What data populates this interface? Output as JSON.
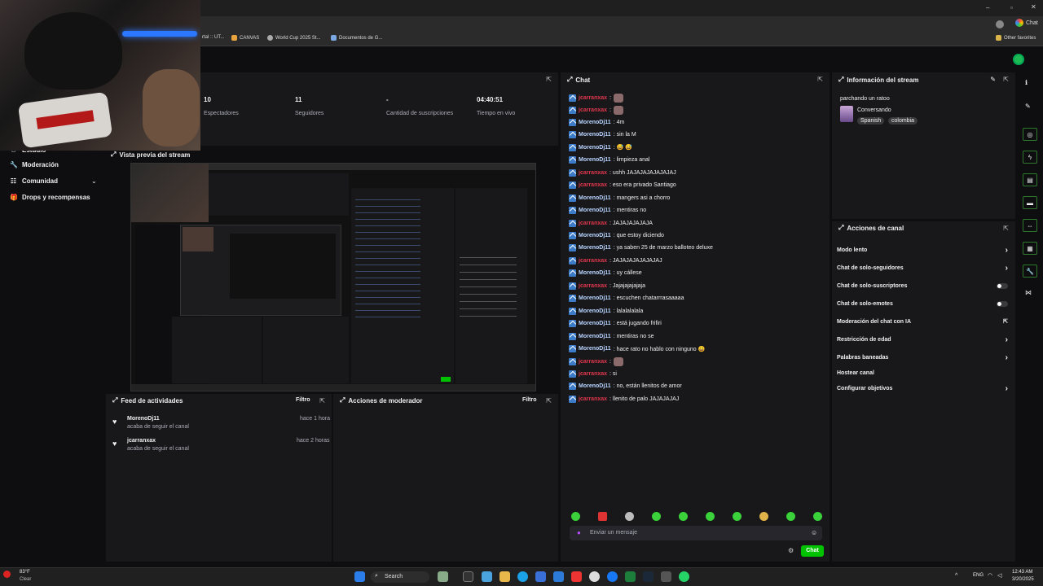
{
  "browser": {
    "bookmarks": [
      {
        "label": "rtal :: UT..."
      },
      {
        "label": "CANVAS"
      },
      {
        "label": "World Cup 2025 St..."
      },
      {
        "label": "Documentos de G..."
      }
    ],
    "other_favorites": "Other favorites",
    "chat_button": "Chat"
  },
  "sidenav": {
    "items": [
      {
        "label": "Estudio",
        "icon": "home-icon"
      },
      {
        "label": "Moderación",
        "icon": "wrench-icon"
      },
      {
        "label": "Comunidad",
        "icon": "community-icon"
      },
      {
        "label": "Drops y recompensas",
        "icon": "gift-icon"
      }
    ]
  },
  "stats": [
    {
      "value": "10",
      "label": "Espectadores"
    },
    {
      "value": "11",
      "label": "Seguidores"
    },
    {
      "value": "-",
      "label": "Cantidad de suscripciones"
    },
    {
      "value": "04:40:51",
      "label": "Tiempo en vivo"
    }
  ],
  "preview": {
    "title": "Vista previa del stream"
  },
  "activity": {
    "title": "Feed de actividades",
    "filter": "Filtro",
    "items": [
      {
        "user": "MorenoDj11",
        "action": "acaba de seguir el canal",
        "time": "hace 1 hora"
      },
      {
        "user": "jcarranxax",
        "action": "acaba de seguir el canal",
        "time": "hace 2 horas"
      }
    ]
  },
  "modactions": {
    "title": "Acciones de moderador",
    "filter": "Filtro"
  },
  "chat": {
    "title": "Chat",
    "messages": [
      {
        "user": "jcarranxax",
        "text": "",
        "emote": true,
        "kind": "u2"
      },
      {
        "user": "jcarranxax",
        "text": "",
        "emote": true,
        "kind": "u2"
      },
      {
        "user": "MorenoDj11",
        "text": ": 4m",
        "emote": false,
        "kind": "u1"
      },
      {
        "user": "MorenoDj11",
        "text": ": sin la M",
        "emote": false,
        "kind": "u1"
      },
      {
        "user": "MorenoDj11",
        "text": ": 😅 😅",
        "emote": false,
        "kind": "u1"
      },
      {
        "user": "MorenoDj11",
        "text": ": limpieza anal",
        "emote": false,
        "kind": "u1"
      },
      {
        "user": "jcarranxax",
        "text": ": ushh JAJAJAJAJAJAJAJ",
        "emote": false,
        "kind": "u2"
      },
      {
        "user": "jcarranxax",
        "text": ": eso era privado Santiago",
        "emote": false,
        "kind": "u2"
      },
      {
        "user": "MorenoDj11",
        "text": ": mangers asi a chorro",
        "emote": false,
        "kind": "u1"
      },
      {
        "user": "MorenoDj11",
        "text": ": mentiras no",
        "emote": false,
        "kind": "u1"
      },
      {
        "user": "jcarranxax",
        "text": ": JAJAJAJAJAJA",
        "emote": false,
        "kind": "u2"
      },
      {
        "user": "MorenoDj11",
        "text": ": que estoy diciendo",
        "emote": false,
        "kind": "u1"
      },
      {
        "user": "MorenoDj11",
        "text": ": ya saben 25 de marzo balloteo deluxe",
        "emote": false,
        "kind": "u1"
      },
      {
        "user": "jcarranxax",
        "text": ": JAJAJAJAJAJAJAJ",
        "emote": false,
        "kind": "u2"
      },
      {
        "user": "MorenoDj11",
        "text": ": uy cállese",
        "emote": false,
        "kind": "u1"
      },
      {
        "user": "jcarranxax",
        "text": ": Jajajajajajaja",
        "emote": false,
        "kind": "u2"
      },
      {
        "user": "MorenoDj11",
        "text": ": escuchen chatarrrasaaaaa",
        "emote": false,
        "kind": "u1"
      },
      {
        "user": "MorenoDj11",
        "text": ": lalalalalala",
        "emote": false,
        "kind": "u1"
      },
      {
        "user": "MorenoDj11",
        "text": ": está jugando frifiri",
        "emote": false,
        "kind": "u1"
      },
      {
        "user": "MorenoDj11",
        "text": ": mentiras no se",
        "emote": false,
        "kind": "u1"
      },
      {
        "user": "MorenoDj11",
        "text": ": hace rato no hablo con ninguno 😄",
        "emote": false,
        "kind": "u1"
      },
      {
        "user": "jcarranxax",
        "text": "",
        "emote": true,
        "kind": "u2"
      },
      {
        "user": "jcarranxax",
        "text": ": si",
        "emote": false,
        "kind": "u2"
      },
      {
        "user": "MorenoDj11",
        "text": ": no, están llenitos de amor",
        "emote": false,
        "kind": "u1"
      },
      {
        "user": "jcarranxax",
        "text": ": llenito de palo JAJAJAJAJ",
        "emote": false,
        "kind": "u2"
      }
    ],
    "placeholder": "Enviar un mensaje",
    "send_label": "Chat"
  },
  "streaminfo": {
    "title": "Información del stream",
    "stream_title": "parchando un ratoo",
    "category": "Conversando",
    "tags": [
      "Spanish",
      "colombia"
    ]
  },
  "channelactions": {
    "title": "Acciones de canal",
    "items": [
      {
        "label": "Modo lento",
        "control": "arrow"
      },
      {
        "label": "Chat de solo-seguidores",
        "control": "arrow"
      },
      {
        "label": "Chat de solo-suscriptores",
        "control": "toggle"
      },
      {
        "label": "Chat de solo-emotes",
        "control": "toggle"
      },
      {
        "label": "Moderación del chat con IA",
        "control": "external"
      },
      {
        "label": "Restricción de edad",
        "control": "arrow"
      },
      {
        "label": "Palabras baneadas",
        "control": "arrow"
      },
      {
        "label": "Hostear canal",
        "control": "none"
      },
      {
        "label": "Configurar objetivos",
        "control": "arrow"
      }
    ]
  },
  "taskbar": {
    "weather_temp": "83°F",
    "weather_text": "Clear",
    "search": "Search",
    "lang": "ENG",
    "time": "12:43 AM",
    "date": "3/20/2025"
  },
  "colors": {
    "accent": "#00c200",
    "panel": "#18181b",
    "bg": "#0e0e10",
    "user1": "#b8d4ff",
    "user2": "#e0374c"
  }
}
